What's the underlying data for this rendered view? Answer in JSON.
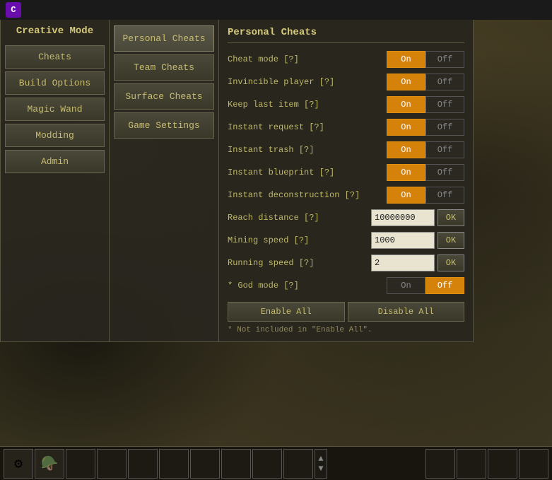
{
  "app": {
    "logo": "C",
    "title": "Creative Mode"
  },
  "topbar": {
    "logo_letter": "C"
  },
  "left_panel": {
    "title": "Creative Mode",
    "buttons": [
      {
        "label": "Cheats",
        "id": "cheats"
      },
      {
        "label": "Build Options",
        "id": "build-options"
      },
      {
        "label": "Magic Wand",
        "id": "magic-wand"
      },
      {
        "label": "Modding",
        "id": "modding"
      },
      {
        "label": "Admin",
        "id": "admin"
      }
    ]
  },
  "middle_panel": {
    "buttons": [
      {
        "label": "Personal Cheats",
        "id": "personal-cheats",
        "active": true
      },
      {
        "label": "Team Cheats",
        "id": "team-cheats",
        "active": false
      },
      {
        "label": "Surface Cheats",
        "id": "surface-cheats",
        "active": false
      },
      {
        "label": "Game Settings",
        "id": "game-settings",
        "active": false
      }
    ]
  },
  "right_panel": {
    "title": "Personal Cheats",
    "settings": [
      {
        "id": "cheat-mode",
        "label": "Cheat mode [?]",
        "type": "toggle",
        "value": "on"
      },
      {
        "id": "invincible-player",
        "label": "Invincible player [?]",
        "type": "toggle",
        "value": "on"
      },
      {
        "id": "keep-last-item",
        "label": "Keep last item [?]",
        "type": "toggle",
        "value": "on"
      },
      {
        "id": "instant-request",
        "label": "Instant request [?]",
        "type": "toggle",
        "value": "on"
      },
      {
        "id": "instant-trash",
        "label": "Instant trash [?]",
        "type": "toggle",
        "value": "on"
      },
      {
        "id": "instant-blueprint",
        "label": "Instant blueprint [?]",
        "type": "toggle",
        "value": "on"
      },
      {
        "id": "instant-deconstruction",
        "label": "Instant deconstruction [?]",
        "type": "toggle",
        "value": "on"
      },
      {
        "id": "reach-distance",
        "label": "Reach distance [?]",
        "type": "input",
        "value": "10000000"
      },
      {
        "id": "mining-speed",
        "label": "Mining speed [?]",
        "type": "input",
        "value": "1000"
      },
      {
        "id": "running-speed",
        "label": "Running speed [?]",
        "type": "input",
        "value": "2"
      },
      {
        "id": "god-mode",
        "label": "* God mode [?]",
        "type": "toggle",
        "value": "off"
      }
    ],
    "enable_all_label": "Enable All",
    "disable_all_label": "Disable All",
    "footnote": "* Not included in \"Enable All\"."
  }
}
